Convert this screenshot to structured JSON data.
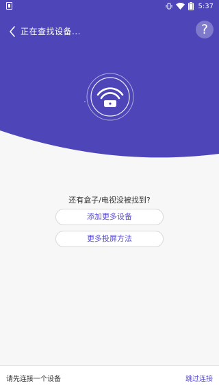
{
  "status_bar": {
    "time": "5:37",
    "icons": [
      "sim-icon",
      "vibrate-icon",
      "wifi-icon",
      "battery-icon"
    ]
  },
  "header": {
    "title": "正在查找设备...",
    "help_label": "?"
  },
  "search": {
    "question": "还有盒子/电视没被找到?",
    "add_more_devices": "添加更多设备",
    "more_casting_methods": "更多投屏方法"
  },
  "footer": {
    "hint": "请先连接一个设备",
    "skip_label": "跳过连接"
  },
  "colors": {
    "primary": "#4e46b8",
    "accent_text": "#5b4fd1",
    "background": "#f7f7f7"
  }
}
